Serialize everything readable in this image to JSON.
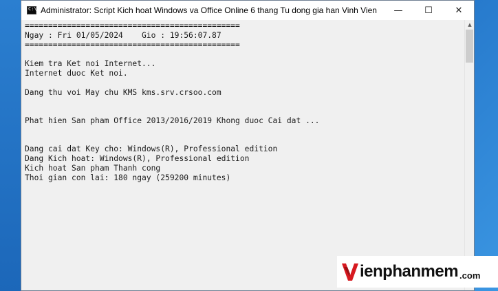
{
  "window": {
    "title": "Administrator:  Script Kich hoat Windows va Office Online 6 thang Tu dong gia han Vinh Vien - Copyright (C) Al...",
    "icon": "cmd-icon",
    "minimize": "—",
    "maximize": "☐",
    "close": "✕"
  },
  "console": {
    "text": "==============================================\nNgay : Fri 01/05/2024    Gio : 19:56:07.87\n==============================================\n\nKiem tra Ket noi Internet...\nInternet duoc Ket noi.\n\nDang thu voi May chu KMS kms.srv.crsoo.com\n\n\nPhat hien San pham Office 2013/2016/2019 Khong duoc Cai dat ...\n\n\nDang cai dat Key cho: Windows(R), Professional edition\nDang Kich hoat: Windows(R), Professional edition\nKich hoat San pham Thanh cong\nThoi gian con lai: 180 ngay (259200 minutes)"
  },
  "watermark": {
    "text": "ienphanmem",
    "suffix": ".com",
    "brand_color": "#d71920"
  }
}
